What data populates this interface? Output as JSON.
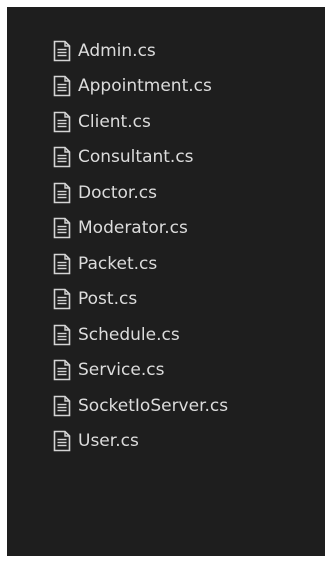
{
  "icons": {
    "file": "document-icon"
  },
  "colors": {
    "panel_background": "#1e1e1e",
    "text": "#dcdcdc",
    "icon_stroke": "#d4d4d4"
  },
  "files": [
    {
      "name": "Admin.cs"
    },
    {
      "name": "Appointment.cs"
    },
    {
      "name": "Client.cs"
    },
    {
      "name": "Consultant.cs"
    },
    {
      "name": "Doctor.cs"
    },
    {
      "name": "Moderator.cs"
    },
    {
      "name": "Packet.cs"
    },
    {
      "name": "Post.cs"
    },
    {
      "name": "Schedule.cs"
    },
    {
      "name": "Service.cs"
    },
    {
      "name": "SocketIoServer.cs"
    },
    {
      "name": "User.cs"
    }
  ]
}
